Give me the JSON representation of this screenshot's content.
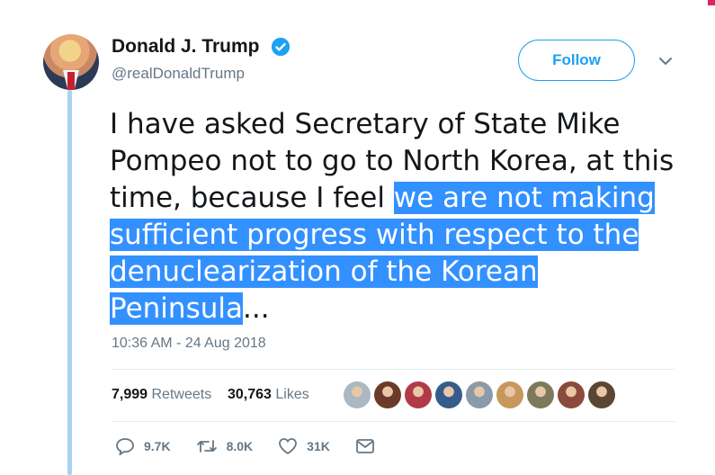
{
  "author": {
    "name": "Donald J. Trump",
    "handle": "@realDonaldTrump",
    "avatar_icon": "profile-photo",
    "verified_icon": "verified-badge-icon"
  },
  "follow_button": {
    "label": "Follow"
  },
  "menu_icon": "chevron-down-icon",
  "tweet": {
    "text_plain": "I have asked Secretary of State Mike Pompeo not to go to North Korea, at this time, because I feel ",
    "text_highlighted": "we are not making sufficient progress with respect to the denuclearization of the Korean Peninsula",
    "text_after": "...",
    "timestamp": "10:36 AM - 24 Aug 2018"
  },
  "stats": {
    "retweets_count": "7,999",
    "retweets_label": "Retweets",
    "likes_count": "30,763",
    "likes_label": "Likes"
  },
  "liker_avatars": [
    {
      "color": "#aab8c2"
    },
    {
      "color": "#6b3b2a"
    },
    {
      "color": "#b23a48"
    },
    {
      "color": "#355c8a"
    },
    {
      "color": "#8a9aa8"
    },
    {
      "color": "#c7985c"
    },
    {
      "color": "#7d7a5c"
    },
    {
      "color": "#8b4a3c"
    },
    {
      "color": "#5a4632"
    }
  ],
  "actions": {
    "replies": "9.7K",
    "retweets": "8.0K",
    "likes": "31K"
  },
  "colors": {
    "accent": "#1da1f2",
    "highlight": "#3390ff",
    "thread_line": "#a8d4ef",
    "muted": "#657786"
  }
}
